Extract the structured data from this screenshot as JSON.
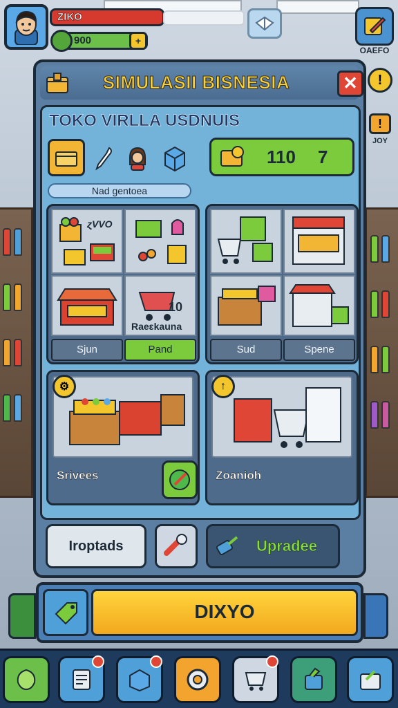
{
  "hud": {
    "player_name": "ZIKO",
    "coins": "900",
    "coin_plus": "+",
    "top_right_label": "OAEFO",
    "help_symbol": "!",
    "alert_symbol": "!",
    "alert_label": "JOY"
  },
  "panel": {
    "title": "SIMULASII BISNESIA",
    "close_symbol": "✕",
    "shop_name": "TOKO VIRLLA USDNUIS",
    "stat_value_1": "110",
    "stat_value_2": "7",
    "sub_label": "Nad ɡentoea"
  },
  "grid_left": {
    "cell_1_label": "ɀVVO",
    "cell_4_label": "Raeɛkauna",
    "cell_4_badge": "10",
    "tabs": [
      "Sjun",
      "Pand"
    ]
  },
  "grid_right": {
    "tabs": [
      "Sud",
      "Spene"
    ]
  },
  "big_cards": {
    "left_label": "Srivees",
    "right_label": "Zoanioh"
  },
  "actions": {
    "button_1": "Iroptads",
    "button_3": "Upradee"
  },
  "bottom": {
    "main_label": "DIXYO"
  },
  "colors": {
    "accent_yellow": "#f6d33d",
    "accent_green": "#7bcb3c",
    "panel_blue": "#5a7fa3",
    "danger_red": "#e04636"
  },
  "icons": {
    "avatar": "player-avatar-icon",
    "settings": "gear-icon",
    "shop": "shop-icon",
    "cart": "cart-icon",
    "check": "check-icon"
  }
}
